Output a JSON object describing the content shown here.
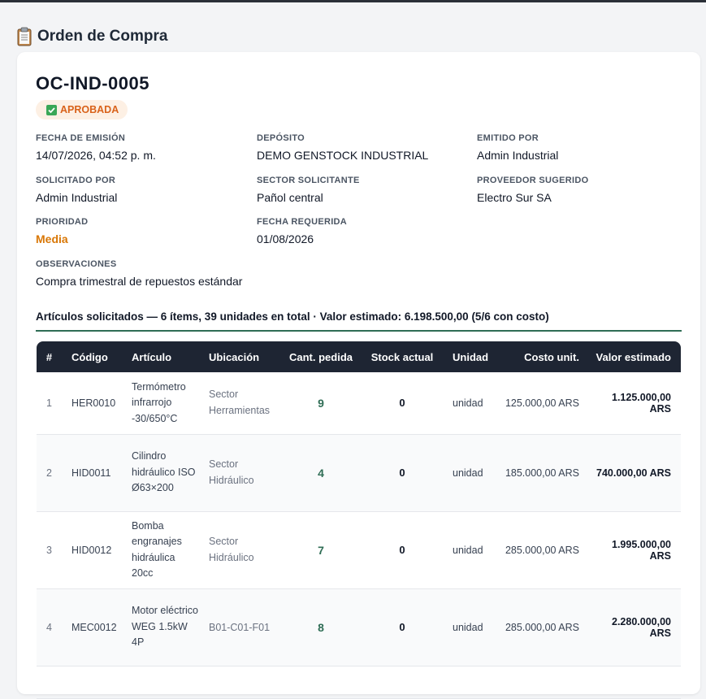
{
  "page": {
    "title": "Orden de Compra",
    "title_icon": "clipboard-icon"
  },
  "order": {
    "number": "OC-IND-0005",
    "status": "APROBADA",
    "status_icon": "check-icon",
    "status_color": "#d9621a",
    "fields": {
      "fecha_emision": {
        "label": "FECHA DE EMISIÓN",
        "value": "14/07/2026, 04:52 p. m."
      },
      "deposito": {
        "label": "DEPÓSITO",
        "value": "DEMO GENSTOCK INDUSTRIAL"
      },
      "emitido_por": {
        "label": "EMITIDO POR",
        "value": "Admin Industrial"
      },
      "solicitado_por": {
        "label": "SOLICITADO POR",
        "value": "Admin Industrial"
      },
      "sector": {
        "label": "SECTOR SOLICITANTE",
        "value": "Pañol central"
      },
      "proveedor": {
        "label": "PROVEEDOR SUGERIDO",
        "value": "Electro Sur SA"
      },
      "prioridad": {
        "label": "PRIORIDAD",
        "value": "Media"
      },
      "fecha_requerida": {
        "label": "FECHA REQUERIDA",
        "value": "01/08/2026"
      },
      "observaciones": {
        "label": "OBSERVACIONES",
        "value": "Compra trimestral de repuestos estándar"
      }
    }
  },
  "summary": "Artículos solicitados — 6 ítems, 39 unidades en total  ·  Valor estimado: 6.198.500,00 (5/6 con costo)",
  "table": {
    "headers": [
      "#",
      "Código",
      "Artículo",
      "Ubicación",
      "Cant. pedida",
      "Stock actual",
      "Unidad",
      "Costo unit.",
      "Valor estimado"
    ],
    "rows": [
      {
        "idx": "1",
        "code": "HER0010",
        "article": "Termómetro infrarrojo -30/650°C",
        "location": "Sector Herramientas",
        "qty": "9",
        "stock": "0",
        "unit": "unidad",
        "unit_cost": "125.000,00 ARS",
        "total": "1.125.000,00 ARS"
      },
      {
        "idx": "2",
        "code": "HID0011",
        "article": "Cilindro hidráulico ISO Ø63×200",
        "location": "Sector Hidráulico",
        "qty": "4",
        "stock": "0",
        "unit": "unidad",
        "unit_cost": "185.000,00 ARS",
        "total": "740.000,00 ARS"
      },
      {
        "idx": "3",
        "code": "HID0012",
        "article": "Bomba engranajes hidráulica 20cc",
        "location": "Sector Hidráulico",
        "qty": "7",
        "stock": "0",
        "unit": "unidad",
        "unit_cost": "285.000,00 ARS",
        "total": "1.995.000,00 ARS"
      },
      {
        "idx": "4",
        "code": "MEC0012",
        "article": "Motor eléctrico WEG 1.5kW 4P",
        "location": "B01-C01-F01",
        "qty": "8",
        "stock": "0",
        "unit": "unidad",
        "unit_cost": "285.000,00 ARS",
        "total": "2.280.000,00 ARS"
      }
    ]
  },
  "colors": {
    "header_bg": "#1e2533",
    "accent_green": "#2f6d55",
    "priority_orange": "#d97706"
  }
}
